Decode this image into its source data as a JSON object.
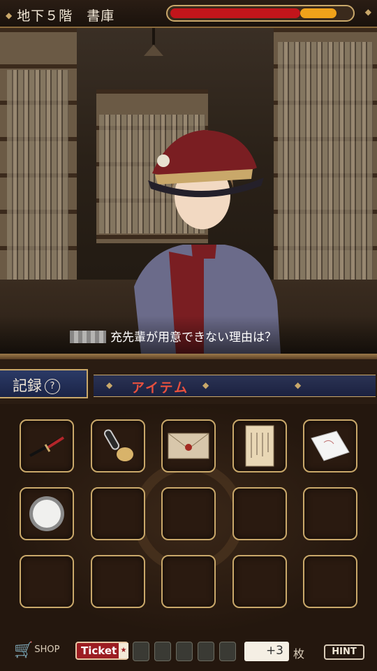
{
  "header": {
    "location": "地下５階　書庫",
    "hp_fraction": 0.72,
    "hp_secondary_fraction": 0.2,
    "hp_colors": {
      "red": "#c2151b",
      "orange": "#f0a21a"
    }
  },
  "dialog": {
    "line": "充先輩が用意できない理由は？"
  },
  "panel": {
    "record_label": "記録",
    "help_label": "?",
    "tab_label": "アイテム"
  },
  "items": [
    {
      "name": "katana-icon",
      "filled": true
    },
    {
      "name": "key-icon",
      "filled": true
    },
    {
      "name": "envelope-icon",
      "filled": true
    },
    {
      "name": "letter-icon",
      "filled": true
    },
    {
      "name": "handkerchief-icon",
      "filled": true
    },
    {
      "name": "mirror-icon",
      "filled": true
    },
    {
      "name": "",
      "filled": false
    },
    {
      "name": "",
      "filled": false
    },
    {
      "name": "",
      "filled": false
    },
    {
      "name": "",
      "filled": false
    },
    {
      "name": "",
      "filled": false
    },
    {
      "name": "",
      "filled": false
    },
    {
      "name": "",
      "filled": false
    },
    {
      "name": "",
      "filled": false
    },
    {
      "name": "",
      "filled": false
    }
  ],
  "footer": {
    "shop_label": "SHOP",
    "ticket_label": "Ticket",
    "ticket_slots": 5,
    "ticket_count": "+3",
    "ticket_unit": "枚",
    "hint_label": "HINT"
  }
}
